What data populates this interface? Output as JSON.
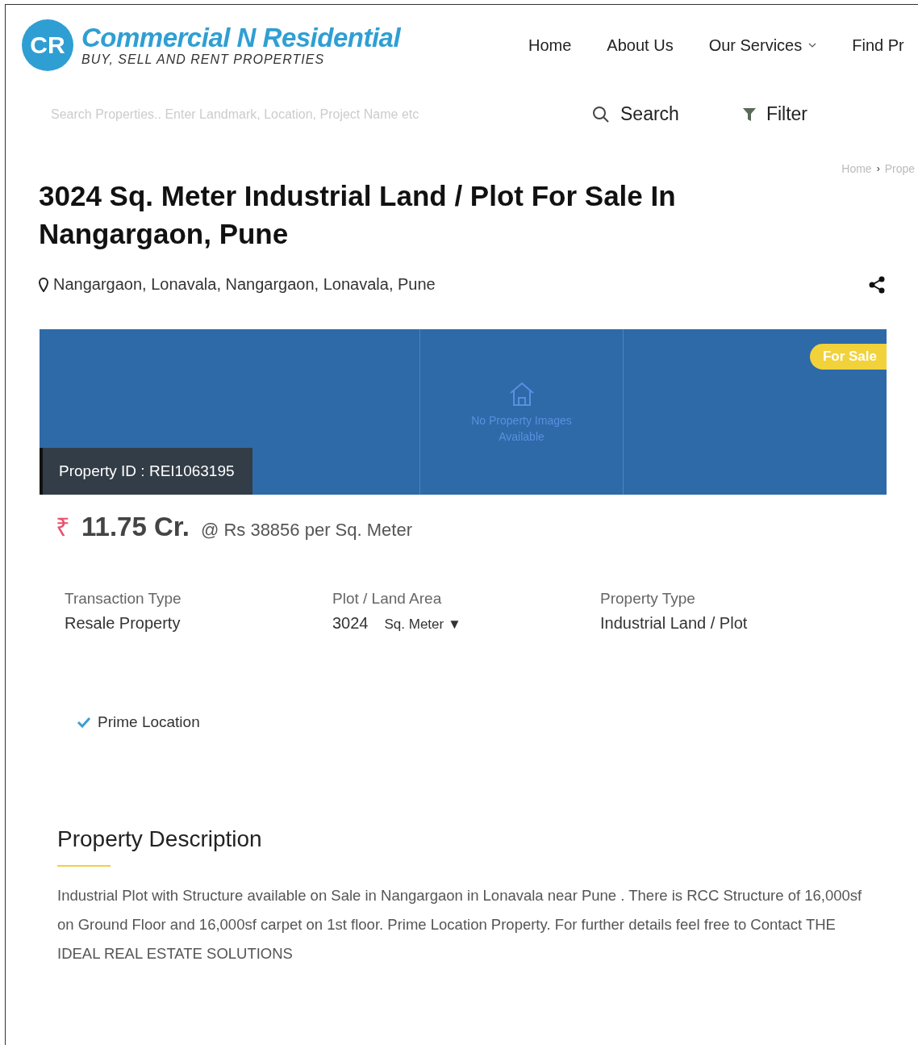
{
  "logo": {
    "initials": "CR",
    "name": "Commercial N Residential",
    "tagline": "BUY, SELL AND RENT PROPERTIES"
  },
  "nav": [
    {
      "label": "Home",
      "dropdown": false
    },
    {
      "label": "About Us",
      "dropdown": false
    },
    {
      "label": "Our Services",
      "dropdown": true
    },
    {
      "label": "Find Pr",
      "dropdown": false
    }
  ],
  "search": {
    "placeholder": "Search Properties.. Enter Landmark, Location, Project Name etc",
    "button": "Search",
    "filter": "Filter"
  },
  "breadcrumb": {
    "items": [
      "Home",
      "Prope"
    ],
    "separator": "›"
  },
  "title": "3024 Sq. Meter Industrial Land / Plot For Sale In Nangargaon, Pune",
  "address": "Nangargaon, Lonavala, Nangargaon, Lonavala, Pune",
  "banner": {
    "placeholder": "No Property Images Available",
    "badge": "For Sale",
    "property_id": "Property ID : REI1063195"
  },
  "price": {
    "currency": "₹",
    "amount": "11.75 Cr.",
    "rate": "@ Rs 38856 per Sq. Meter"
  },
  "details": [
    {
      "label": "Transaction Type",
      "value": "Resale Property"
    },
    {
      "label": "Plot / Land Area",
      "value": "3024",
      "unit": "Sq. Meter ▼"
    },
    {
      "label": "Property Type",
      "value": "Industrial Land / Plot"
    }
  ],
  "features": [
    "Prime Location"
  ],
  "description": {
    "heading": "Property Description",
    "text": "Industrial Plot with Structure available on Sale in Nangargaon in Lonavala near Pune . There is RCC Structure of 16,000sf on Ground Floor and 16,000sf carpet on 1st floor. Prime Location Property. For further details feel free to Contact THE IDEAL REAL ESTATE SOLUTIONS"
  }
}
